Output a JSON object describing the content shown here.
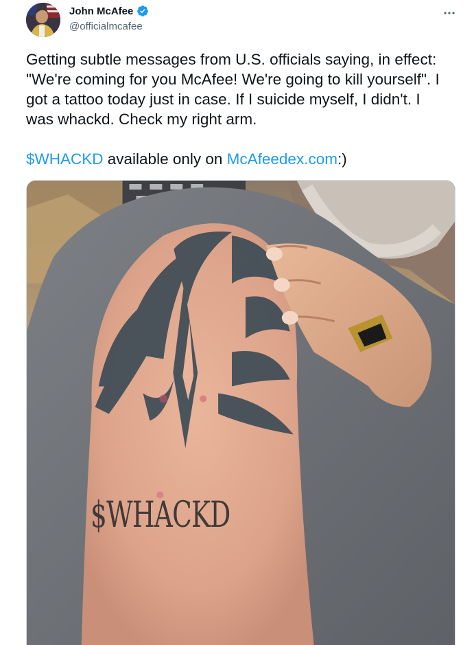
{
  "author": {
    "display_name": "John McAfee",
    "handle": "@officialmcafee",
    "verified": true,
    "avatar_icon": "profile-photo"
  },
  "more_icon": "ellipsis-icon",
  "tweet": {
    "paragraph1": "Getting subtle messages from U.S. officials saying, in effect: \"We're coming for you McAfee! We're going to kill yourself\". I got a tattoo today just in case. If I suicide myself, I didn't. I was whackd. Check my right arm.",
    "cashtag": "$WHACKD",
    "middle": " available only on ",
    "url": "McAfeedex.com",
    "suffix": ":)"
  },
  "media": {
    "tattoo_text": "$WHACKD"
  },
  "colors": {
    "link": "#1d9bf0",
    "text": "#0f1419",
    "secondary": "#536471",
    "verified": "#1d9bf0"
  }
}
